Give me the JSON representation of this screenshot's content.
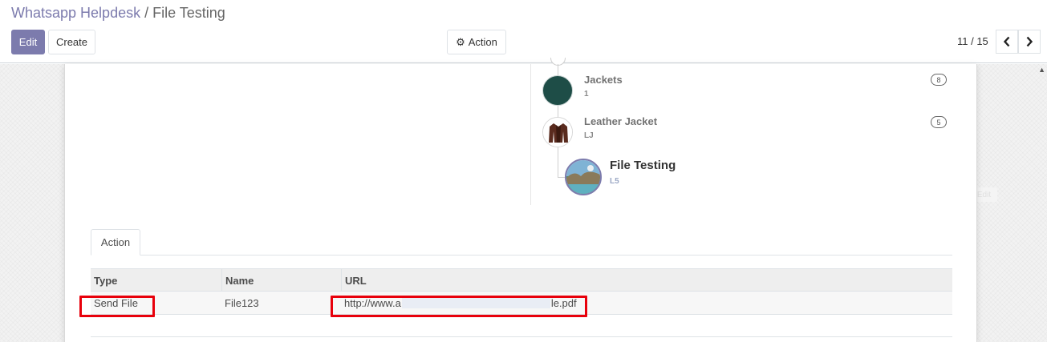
{
  "breadcrumb": {
    "parent": "Whatsapp Helpdesk",
    "separator": "/",
    "current": "File Testing"
  },
  "toolbar": {
    "edit_label": "Edit",
    "create_label": "Create",
    "action_label": "Action",
    "action_icon": "gear-icon"
  },
  "pager": {
    "value": "11 / 15",
    "prev_icon": "chevron-left-icon",
    "next_icon": "chevron-right-icon"
  },
  "hierarchy": {
    "nodes": [
      {
        "name": "Jackets",
        "code": "1",
        "count": "8"
      },
      {
        "name": "Leather Jacket",
        "code": "LJ",
        "count": "5"
      },
      {
        "name": "File Testing",
        "code": "L5"
      }
    ]
  },
  "faded_label": "Edit",
  "tabs": [
    {
      "label": "Action"
    }
  ],
  "table": {
    "headers": [
      "Type",
      "Name",
      "URL"
    ],
    "rows": [
      {
        "type": "Send File",
        "name": "File123",
        "url_prefix": "http://www.a",
        "url_suffix": "le.pdf"
      }
    ]
  },
  "colors": {
    "primary": "#7c7bad",
    "highlight": "#e8000b",
    "jackets_avatar": "#1e4d47"
  }
}
